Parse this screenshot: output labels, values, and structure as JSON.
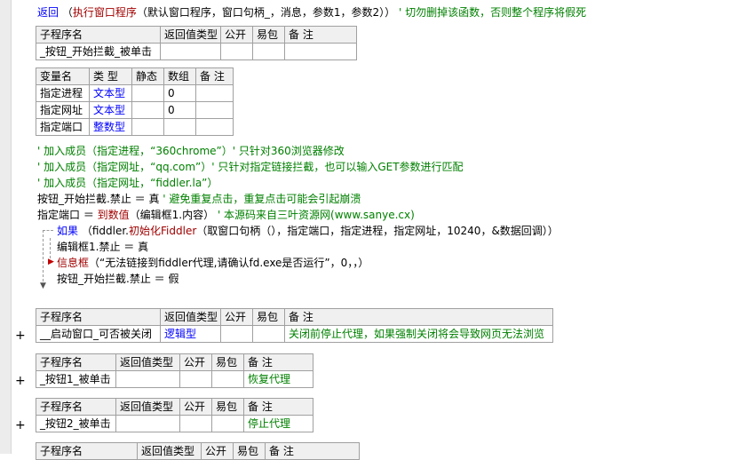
{
  "top_line": {
    "return_kw": "返回",
    "open": "（",
    "call_kw": "执行窗口程序",
    "args": "（默认窗口程序，窗口句柄_，消息，参数1，参数2））",
    "comment": "' 切勿删掉该函数，否则整个程序将假死"
  },
  "sub_header": [
    "子程序名",
    "返回值类型",
    "公开",
    "易包",
    "备 注"
  ],
  "var_header": [
    "变量名",
    "类 型",
    "静态",
    "数组",
    "备 注"
  ],
  "sub1": {
    "name": "_按钮_开始拦截_被单击",
    "ret": "",
    "pub": "",
    "pkg": "",
    "note": ""
  },
  "vars": [
    {
      "name": "指定进程",
      "type": "文本型",
      "static": "",
      "array": "0",
      "note": ""
    },
    {
      "name": "指定网址",
      "type": "文本型",
      "static": "",
      "array": "0",
      "note": ""
    },
    {
      "name": "指定端口",
      "type": "整数型",
      "static": "",
      "array": "",
      "note": ""
    }
  ],
  "code": {
    "l1": "' 加入成员（指定进程，“360chrome”）' 只针对360浏览器修改",
    "l2": "' 加入成员（指定网址，“qq.com”）' 只针对指定链接拦截，也可以输入GET参数进行匹配",
    "l3": "' 加入成员（指定网址，“fiddler.la”）",
    "l4_a": "按钮_开始拦截.禁止 ＝ 真",
    "l4_b": "' 避免重复点击，重复点击可能会引起崩溃",
    "l5_a": "指定端口 ＝ ",
    "l5_kw": "到数值",
    "l5_b": "（编辑框1.内容）",
    "l5_c": "' 本源码来自三叶资源网(www.sanye.cx)",
    "l6_kw": "如果",
    "l6_a": "（fiddler.",
    "l6_fn": "初始化Fiddler",
    "l6_b": "（取窗口句柄（），指定端口，指定进程，指定网址，10240，&数据回调））",
    "l7": "编辑框1.禁止 ＝ 真",
    "l8_kw": "信息框",
    "l8_a": "（“无法链接到fiddler代理,请确认fd.exe是否运行”，0，，）",
    "l9": "按钮_开始拦截.禁止 ＝ 假"
  },
  "sub2": {
    "plus": "+",
    "name": "__启动窗口_可否被关闭",
    "ret": "逻辑型",
    "pub": "",
    "pkg": "",
    "note": "关闭前停止代理，如果强制关闭将会导致网页无法浏览"
  },
  "sub3": {
    "plus": "+",
    "name": "_按钮1_被单击",
    "ret": "",
    "pub": "",
    "pkg": "",
    "note": "恢复代理"
  },
  "sub4": {
    "plus": "+",
    "name": "_按钮2_被单击",
    "ret": "",
    "pub": "",
    "pkg": "",
    "note": "停止代理"
  },
  "sub5_header": [
    "子程序名",
    "返回值类型",
    "公开",
    "易包",
    "备 注"
  ]
}
